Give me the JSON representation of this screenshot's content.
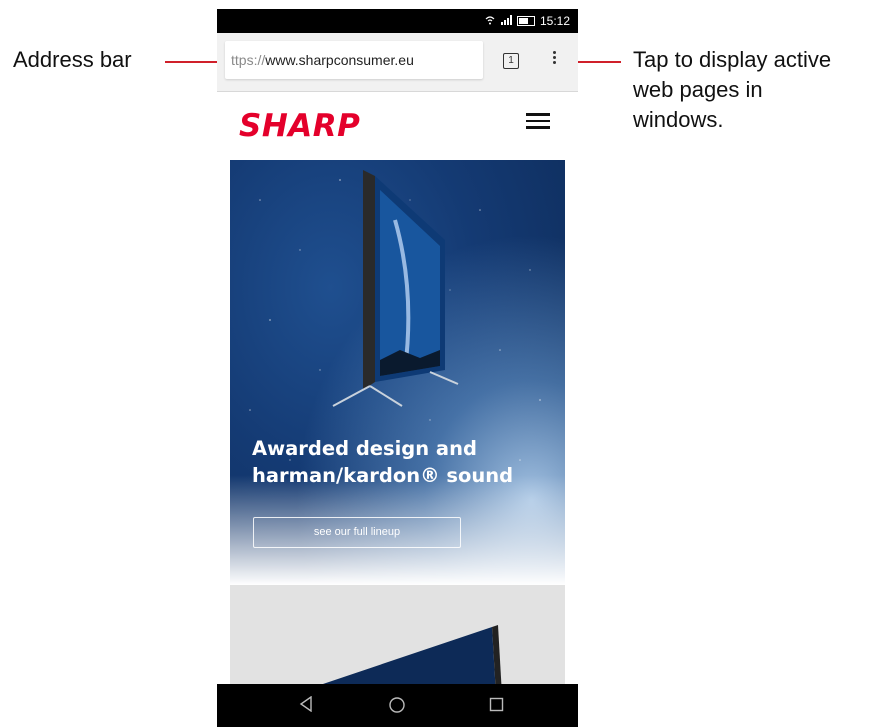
{
  "callouts": {
    "address_bar": "Address bar",
    "tabs_line1": "Tap to display active",
    "tabs_line2": "web pages in",
    "tabs_line3": "windows."
  },
  "status_bar": {
    "time": "15:12",
    "icons": [
      "wifi-icon",
      "signal-icon",
      "battery-icon"
    ]
  },
  "browser": {
    "url_scheme": "ttps://",
    "url_host": "www.sharpconsumer.eu",
    "tab_count": "1"
  },
  "site": {
    "brand": "SHARP",
    "hero_title_line1": "Awarded design and",
    "hero_title_line2": "harman/kardon® sound",
    "hero_button": "see our full lineup"
  },
  "colors": {
    "brand_red": "#e4002b",
    "callout_line": "#d0202a",
    "hero_blue": "#143a73"
  }
}
